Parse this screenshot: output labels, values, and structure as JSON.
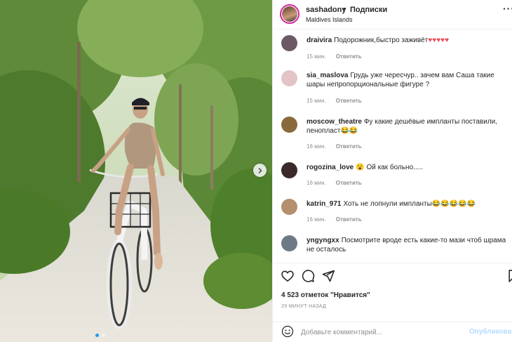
{
  "post": {
    "username": "sashadony",
    "separator": "•",
    "follow_label": "Подписки",
    "location": "Maldives Islands",
    "more_label": "···"
  },
  "comments": [
    {
      "user": "draivira",
      "text": "Подорожник,быстро заживёт♥♥♥♥♥",
      "time": "15 мин.",
      "reply": "Ответить",
      "avatar_color": "#6b5a66"
    },
    {
      "user": "sia_maslova",
      "text": "Грудь уже чересчур.. зачем вам Саша такие шары непропорциональные фигуре ?",
      "time": "15 мин.",
      "reply": "Ответить",
      "avatar_color": "#e3c4c6"
    },
    {
      "user": "moscow_theatre",
      "text": "Фу какие дешёвые импланты поставили, пенопласт😂😂",
      "time": "16 мин.",
      "reply": "Ответить",
      "avatar_color": "#8a6a3c"
    },
    {
      "user": "rogozina_love",
      "text": "😮 Ой как больно.....",
      "time": "16 мин.",
      "reply": "Ответить",
      "avatar_color": "#3a2a2a"
    },
    {
      "user": "katrin_971",
      "text": "Хоть не лопнули импланты😂😂😂😂😂",
      "time": "16 мин.",
      "reply": "Ответить",
      "avatar_color": "#b38f6d"
    },
    {
      "user": "yngyngxx",
      "text": "Посмотрите вроде есть какие-то мази чтоб шрама не осталось",
      "time": "",
      "reply": "",
      "avatar_color": "#6d7a85"
    }
  ],
  "actions": {
    "likes": "4 523 отметок \"Нравится\"",
    "posted_ago": "29 МИНУТ НАЗАД"
  },
  "composer": {
    "placeholder": "Добавьте комментарий...",
    "publish_label": "Опубликовать"
  },
  "carousel": {
    "dot_count": 2,
    "active_index": 0
  },
  "colors": {
    "accent": "#0095f6",
    "publish_disabled": "#b3dbff",
    "border": "#efefef",
    "meta_text": "#8e8e8e",
    "heart_red": "#ed4956"
  },
  "icons": [
    "heart-icon",
    "comment-icon",
    "share-icon",
    "bookmark-icon",
    "emoji-icon",
    "chevron-right-icon"
  ]
}
